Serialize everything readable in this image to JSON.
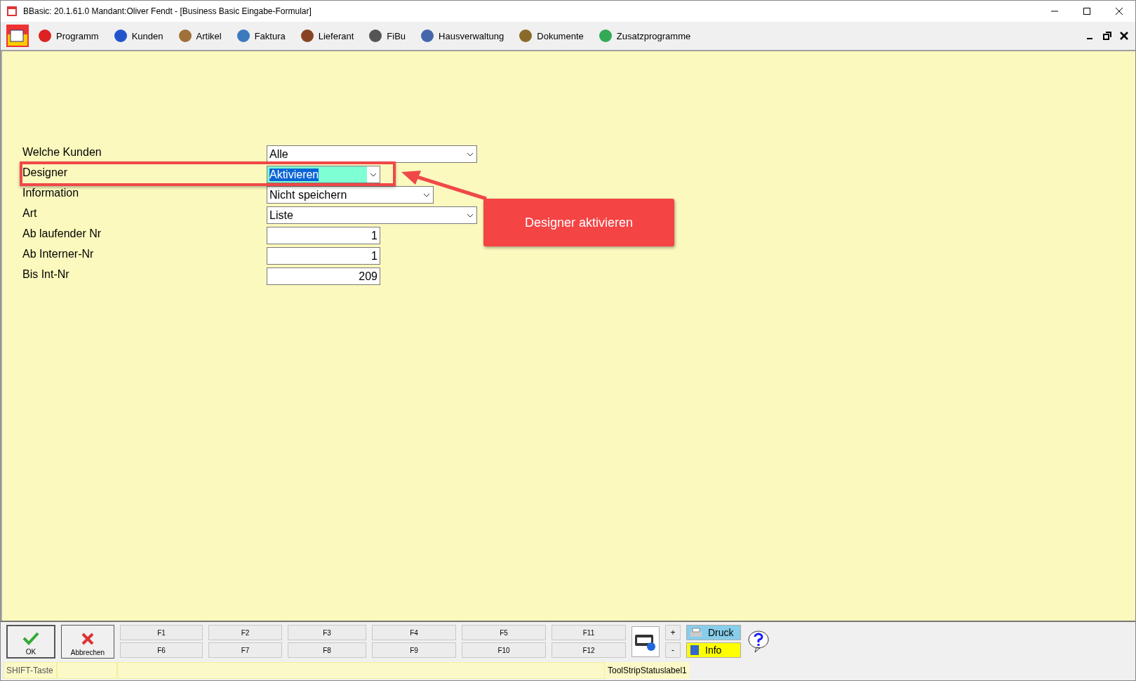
{
  "window": {
    "title": "BBasic: 20.1.61.0 Mandant:Oliver Fendt  - [Business Basic Eingabe-Formular]"
  },
  "menu": [
    {
      "label": "Programm"
    },
    {
      "label": "Kunden"
    },
    {
      "label": "Artikel"
    },
    {
      "label": "Faktura"
    },
    {
      "label": "Lieferant"
    },
    {
      "label": "FiBu"
    },
    {
      "label": "Hausverwaltung"
    },
    {
      "label": "Dokumente"
    },
    {
      "label": "Zusatzprogramme"
    }
  ],
  "form": [
    {
      "label": "Welche Kunden",
      "kind": "combo",
      "value": "Alle",
      "highlighted": false
    },
    {
      "label": "Designer",
      "kind": "combo",
      "value": "Aktivieren",
      "highlighted": true
    },
    {
      "label": "Information",
      "kind": "combo",
      "value": "Nicht speichern",
      "highlighted": false
    },
    {
      "label": "Art",
      "kind": "combo",
      "value": "Liste",
      "highlighted": false
    },
    {
      "label": "Ab laufender Nr",
      "kind": "number",
      "value": "1",
      "highlighted": false
    },
    {
      "label": "Ab Interner-Nr",
      "kind": "number",
      "value": "1",
      "highlighted": false
    },
    {
      "label": "Bis Int-Nr",
      "kind": "number",
      "value": "209",
      "highlighted": false
    }
  ],
  "annotation": {
    "text": "Designer aktivieren"
  },
  "buttons": {
    "ok": "OK",
    "cancel": "Abbrechen",
    "fkeys": [
      [
        "F1",
        "F6"
      ],
      [
        "F2",
        "F7"
      ],
      [
        "F3",
        "F8"
      ],
      [
        "F4",
        "F9"
      ],
      [
        "F5",
        "F10"
      ],
      [
        "F11",
        "F12"
      ]
    ],
    "plus": "+",
    "minus": "-",
    "print": "Druck",
    "info": "Info"
  },
  "status_bar": [
    "SHIFT-Taste",
    "ToolStripStatuslabel1"
  ]
}
